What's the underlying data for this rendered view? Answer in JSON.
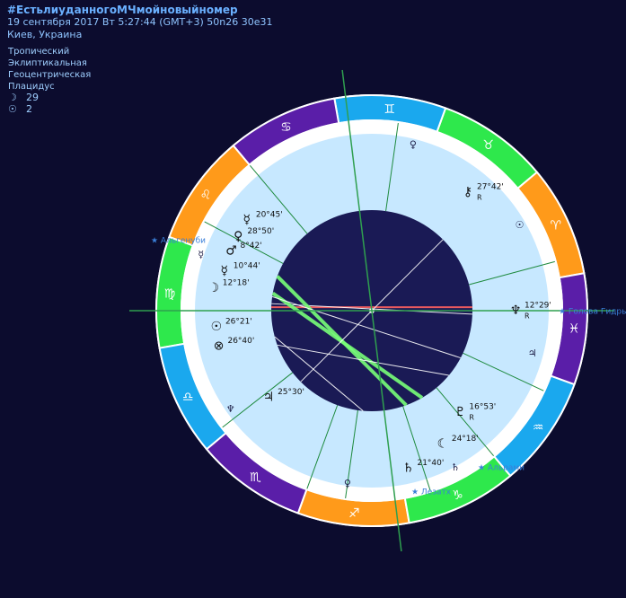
{
  "header": {
    "title": "#ЕстьлиуданногоМЧмойновыйномер",
    "datetime": "19 сентября 2017  Вт   5:27:44 (GMT+3) 50n26  30e31",
    "location": "Киев, Украина"
  },
  "settings": [
    "Тропический",
    "Эклиптикальная",
    "Геоцентрическая",
    "Плацидус"
  ],
  "counts": [
    {
      "icon": "moon-icon",
      "glyph": "☽",
      "value": "29"
    },
    {
      "icon": "sun-icon",
      "glyph": "☉",
      "value": "2"
    }
  ],
  "colors": {
    "background": "#0c0c2e",
    "inner_disc": "#1a1a55",
    "house_zone": "#c7e8ff",
    "fire": "#ff9a1a",
    "earth": "#2ee84c",
    "air": "#1aa8ee",
    "water": "#5a1ea8",
    "aspect_green": "#78ff78",
    "aspect_red": "#ff4040"
  },
  "zodiac": [
    {
      "name": "aries",
      "glyph": "♈",
      "element": "fire"
    },
    {
      "name": "taurus",
      "glyph": "♉",
      "element": "earth"
    },
    {
      "name": "gemini",
      "glyph": "♊",
      "element": "air"
    },
    {
      "name": "cancer",
      "glyph": "♋",
      "element": "water"
    },
    {
      "name": "leo",
      "glyph": "♌",
      "element": "fire"
    },
    {
      "name": "virgo",
      "glyph": "♍",
      "element": "earth"
    },
    {
      "name": "libra",
      "glyph": "♎",
      "element": "air"
    },
    {
      "name": "scorpio",
      "glyph": "♏",
      "element": "water"
    },
    {
      "name": "sagittarius",
      "glyph": "♐",
      "element": "fire"
    },
    {
      "name": "capricorn",
      "glyph": "♑",
      "element": "earth"
    },
    {
      "name": "aquarius",
      "glyph": "♒",
      "element": "air"
    },
    {
      "name": "pisces",
      "glyph": "♓",
      "element": "water"
    }
  ],
  "planets": [
    {
      "name": "mercury",
      "glyph": "☿",
      "degree": "20°45'",
      "retro": ""
    },
    {
      "name": "venus",
      "glyph": "♀",
      "degree": "28°50'",
      "retro": ""
    },
    {
      "name": "mars",
      "glyph": "♂",
      "degree": "8°42'",
      "retro": ""
    },
    {
      "name": "mercury-2",
      "glyph": "☿",
      "degree": "10°44'",
      "retro": ""
    },
    {
      "name": "moon",
      "glyph": "☽",
      "degree": "12°18'",
      "retro": ""
    },
    {
      "name": "sun",
      "glyph": "☉",
      "degree": "26°21'",
      "retro": ""
    },
    {
      "name": "fortune",
      "glyph": "⊗",
      "degree": "26°40'",
      "retro": ""
    },
    {
      "name": "jupiter",
      "glyph": "♃",
      "degree": "25°30'",
      "retro": ""
    },
    {
      "name": "pluto",
      "glyph": "♇",
      "degree": "16°53'",
      "retro": "R"
    },
    {
      "name": "lilith",
      "glyph": "☾",
      "degree": "24°18'",
      "retro": ""
    },
    {
      "name": "saturn",
      "glyph": "♄",
      "degree": "21°40'",
      "retro": ""
    },
    {
      "name": "neptune",
      "glyph": "♆",
      "degree": "12°29'",
      "retro": "R"
    },
    {
      "name": "chiron",
      "glyph": "⚷",
      "degree": "27°42'",
      "retro": "R"
    }
  ],
  "house_symbols": [
    {
      "name": "venus-house",
      "glyph": "♀"
    },
    {
      "name": "sun-house",
      "glyph": "☉"
    },
    {
      "name": "jupiter-house",
      "glyph": "♃"
    },
    {
      "name": "mercury-house",
      "glyph": "☿"
    },
    {
      "name": "neptune-house",
      "glyph": "♆"
    },
    {
      "name": "venus-house-2",
      "glyph": "♀"
    },
    {
      "name": "saturn-house",
      "glyph": "♄"
    }
  ],
  "stars": [
    "Альгенуби",
    "Голова Гидры",
    "Альрами",
    "Лезатх"
  ]
}
